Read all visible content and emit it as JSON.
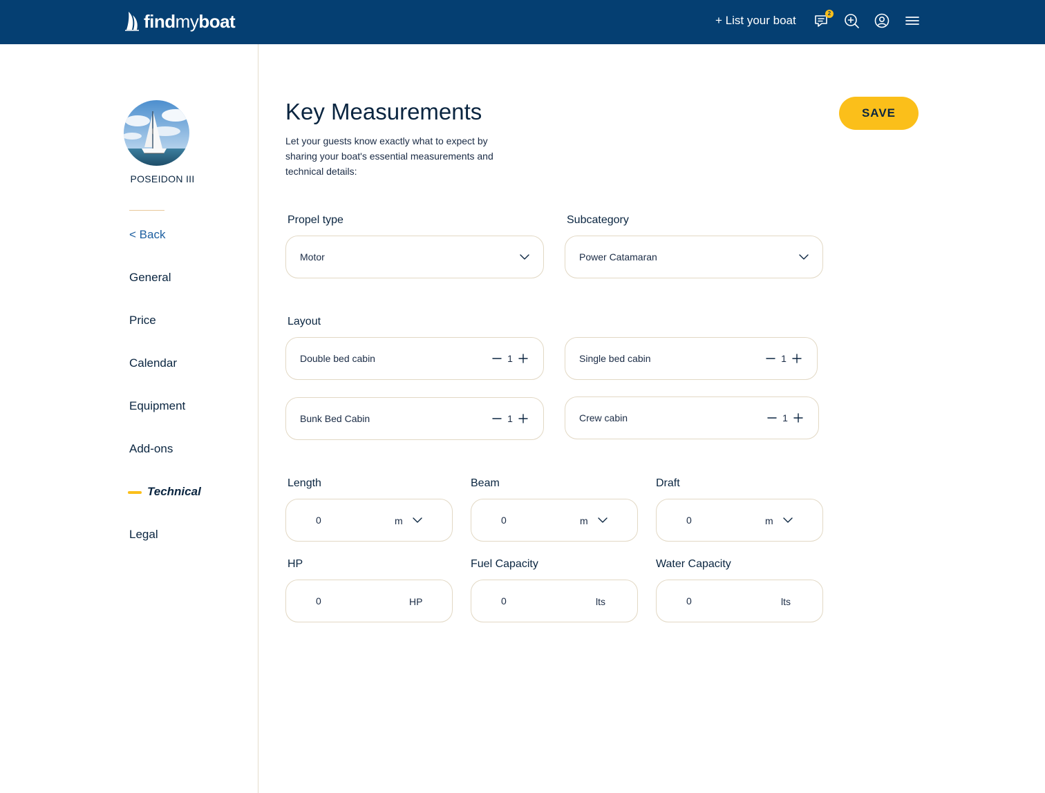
{
  "header": {
    "logo_find": "find",
    "logo_my": "my",
    "logo_boat": "boat",
    "list_boat": "+ List your boat",
    "messages_badge": "2",
    "icons": [
      "messages-icon",
      "search-zoom-icon",
      "user-icon",
      "menu-icon"
    ]
  },
  "sidebar": {
    "boat_name": "POSEIDON III",
    "back": "< Back",
    "items": [
      "General",
      "Price",
      "Calendar",
      "Equipment",
      "Add-ons",
      "Technical",
      "Legal"
    ],
    "active": "Technical"
  },
  "main": {
    "title": "Key Measurements",
    "description": "Let your guests know exactly what to expect by sharing your boat's essential measurements and technical details:",
    "save": "SAVE",
    "propel_type": {
      "label": "Propel type",
      "value": "Motor"
    },
    "subcategory": {
      "label": "Subcategory",
      "value": "Power Catamaran"
    },
    "layout": {
      "label": "Layout",
      "cabins": [
        {
          "name": "Double bed cabin",
          "count": "1"
        },
        {
          "name": "Single bed cabin",
          "count": "1"
        },
        {
          "name": "Bunk Bed Cabin",
          "count": "1"
        },
        {
          "name": "Crew cabin",
          "count": "1"
        }
      ]
    },
    "measures": [
      {
        "label": "Length",
        "value": "0",
        "unit": "m"
      },
      {
        "label": "Beam",
        "value": "0",
        "unit": "m"
      },
      {
        "label": "Draft",
        "value": "0",
        "unit": "m"
      },
      {
        "label": "HP",
        "value": "0",
        "unit": "HP"
      },
      {
        "label": "Fuel Capacity",
        "value": "0",
        "unit": "lts"
      },
      {
        "label": "Water Capacity",
        "value": "0",
        "unit": "lts"
      }
    ]
  },
  "colors": {
    "header_bg": "#053f72",
    "accent": "#fbbf1a",
    "field_border": "#e2d8c4",
    "text": "#0a2540"
  }
}
